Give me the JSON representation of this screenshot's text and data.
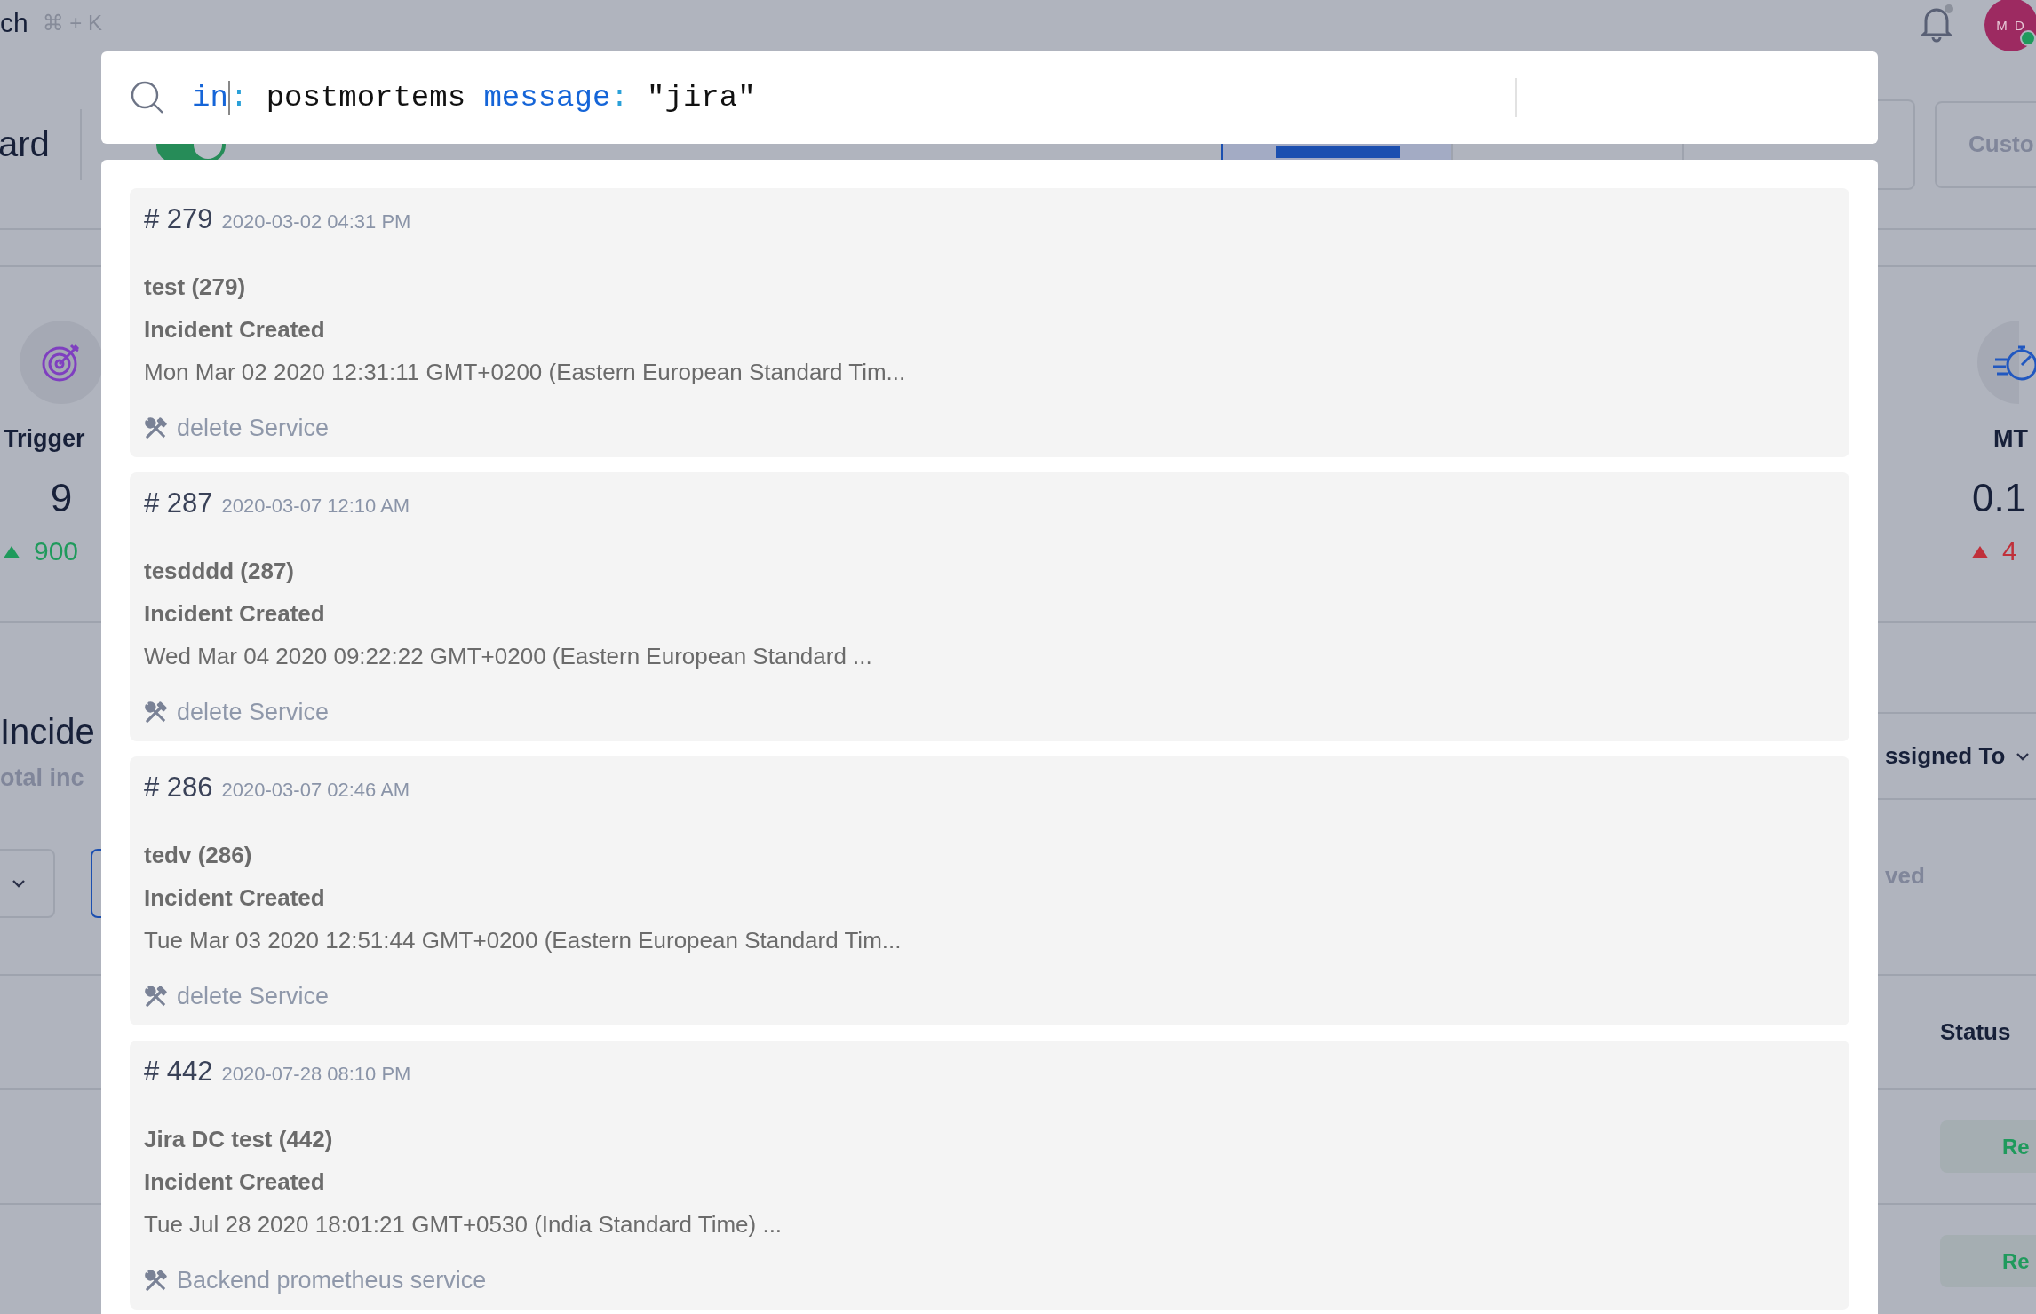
{
  "topbar": {
    "search_label": "ch",
    "shortcut": "⌘ + K",
    "avatar": {
      "initials": "M D",
      "online": true
    }
  },
  "toolbar": {
    "title": "ard",
    "scope_toggle": {
      "on": true
    },
    "ranges": [
      {
        "selected": true
      },
      {
        "selected": false
      },
      {
        "selected": false
      }
    ],
    "custom_button": "Custo"
  },
  "stats": [
    {
      "label": "Trigger",
      "value": "9",
      "change": "900",
      "color": "#1f9a5c"
    },
    {
      "label": "MT",
      "value": "0.1",
      "change": "4",
      "color": "#c0303a"
    }
  ],
  "incidents": {
    "title": "Incide",
    "subtitle": "otal inc",
    "filter_label": "ssigned To",
    "summary": [
      {
        "label": "ved"
      }
    ]
  },
  "table": {
    "columns": [
      "Status"
    ],
    "rows": [
      {
        "status": "Re"
      },
      {
        "status": "Re"
      }
    ]
  },
  "search": {
    "query_tokens": [
      {
        "text": "in",
        "kind": "field",
        "caret": true
      },
      {
        "text": ":",
        "kind": "colon",
        "caret": false
      },
      {
        "text": "postmortems",
        "kind": "term",
        "caret": false
      },
      {
        "text": "message",
        "kind": "field",
        "caret": false
      },
      {
        "text": ":",
        "kind": "colon",
        "caret": false
      },
      {
        "text": "\"jira\"",
        "kind": "term",
        "caret": false
      }
    ]
  },
  "results": [
    {
      "number": "# 279",
      "time": "2020-03-02 04:31 PM",
      "title": "test (279)",
      "event": "Incident Created",
      "message": "Mon Mar 02 2020 12:31:11 GMT+0200 (Eastern European Standard Tim...",
      "service": "delete Service"
    },
    {
      "number": "# 287",
      "time": "2020-03-07 12:10 AM",
      "title": "tesdddd (287)",
      "event": "Incident Created",
      "message": "Wed Mar 04 2020 09:22:22 GMT+0200 (Eastern European Standard ...",
      "service": "delete Service"
    },
    {
      "number": "# 286",
      "time": "2020-03-07 02:46 AM",
      "title": "tedv (286)",
      "event": "Incident Created",
      "message": "Tue Mar 03 2020 12:51:44 GMT+0200 (Eastern European Standard Tim...",
      "service": "delete Service"
    },
    {
      "number": "# 442",
      "time": "2020-07-28 08:10 PM",
      "title": "Jira DC test (442)",
      "event": "Incident Created",
      "message": "Tue Jul 28 2020 18:01:21 GMT+0530 (India Standard Time) ...",
      "service": "Backend prometheus service"
    }
  ]
}
